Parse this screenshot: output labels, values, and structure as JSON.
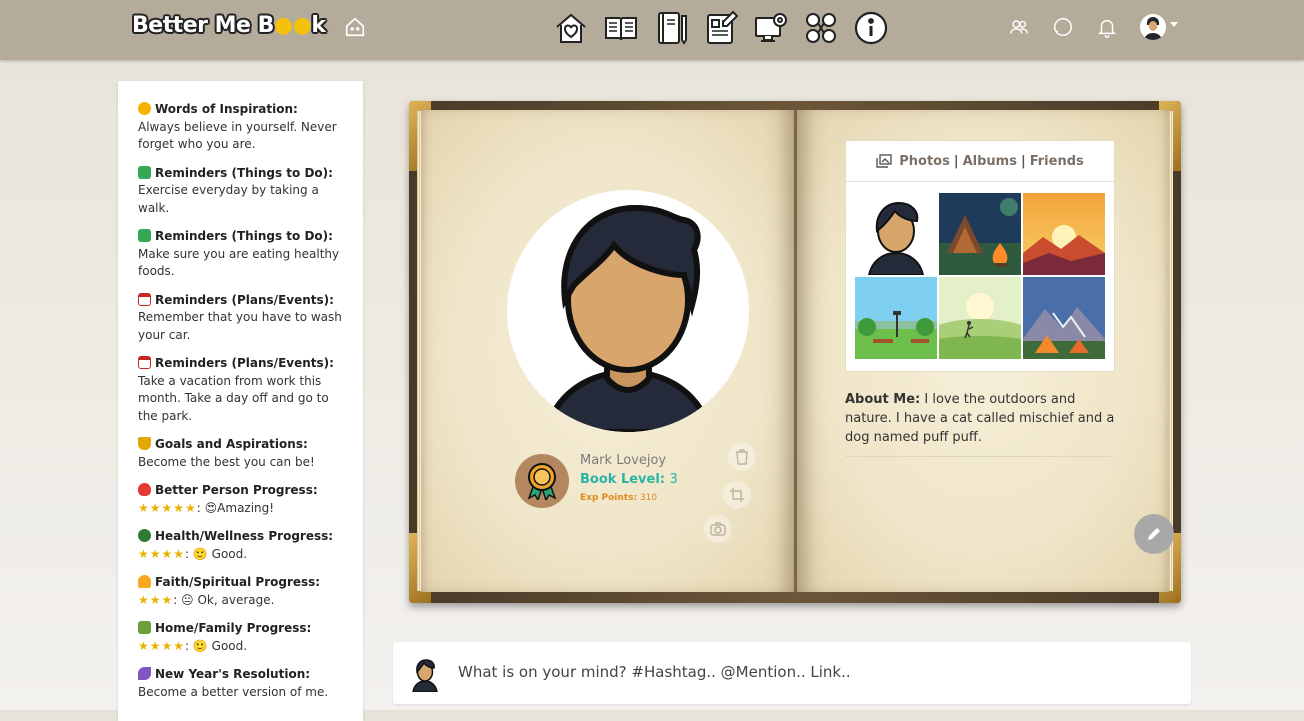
{
  "header": {
    "logo_text": "Better Me B",
    "logo_text_end": "k",
    "nav_icons": [
      "home-heart-icon",
      "notebook-icon",
      "journal-icon",
      "planner-icon",
      "monitor-gear-icon",
      "social-network-icon",
      "info-icon"
    ],
    "right_icons": [
      "friends-icon",
      "chat-icon",
      "bell-icon",
      "user-avatar"
    ]
  },
  "sidebar": {
    "items": [
      {
        "title": "Words of Inspiration:",
        "text": "Always believe in yourself. Never forget who you are.",
        "emoji_color": "#f4b400"
      },
      {
        "title": "Reminders (Things to Do):",
        "text": "Exercise everyday by taking a walk.",
        "emoji_color": "#34a853"
      },
      {
        "title": "Reminders (Things to Do):",
        "text": "Make sure you are eating healthy foods.",
        "emoji_color": "#34a853"
      },
      {
        "title": "Reminders (Plans/Events):",
        "text": "Remember that you have to wash your car.",
        "emoji_color": "#e8eaed"
      },
      {
        "title": "Reminders (Plans/Events):",
        "text": "Take a vacation from work this month. Take a day off and go to the park.",
        "emoji_color": "#e8eaed"
      },
      {
        "title": "Goals and Aspirations:",
        "text": "Become the best you can be!",
        "emoji_color": "#e0a800"
      },
      {
        "title": "Better Person Progress:",
        "stars": "★★★★★",
        "text": ": 😍Amazing!",
        "emoji_color": "#e53935"
      },
      {
        "title": "Health/Wellness Progress:",
        "stars": "★★★★",
        "text": ": 🙂 Good.",
        "emoji_color": "#2e7d32"
      },
      {
        "title": "Faith/Spiritual Progress:",
        "stars": "★★★",
        "text": ": 😐 Ok, average.",
        "emoji_color": "#f9a825"
      },
      {
        "title": "Home/Family Progress:",
        "stars": "★★★★",
        "text": ": 🙂 Good.",
        "emoji_color": "#6d9e3a"
      },
      {
        "title": "New Year's Resolution:",
        "text": "Become a better version of me.",
        "emoji_color": "#7e57c2"
      }
    ]
  },
  "profile": {
    "name": "Mark Lovejoy",
    "level_label": "Book Level:",
    "level_value": "3",
    "exp_label": "Exp Points:",
    "exp_value": "310"
  },
  "photos": {
    "tabs": [
      "Photos",
      "Albums",
      "Friends"
    ],
    "sep": "|"
  },
  "about": {
    "label": "About Me:",
    "text": "I love the outdoors and nature. I have a cat called mischief and a dog named puff puff."
  },
  "post": {
    "placeholder": "What is on your mind? #Hashtag.. @Mention.. Link.."
  }
}
